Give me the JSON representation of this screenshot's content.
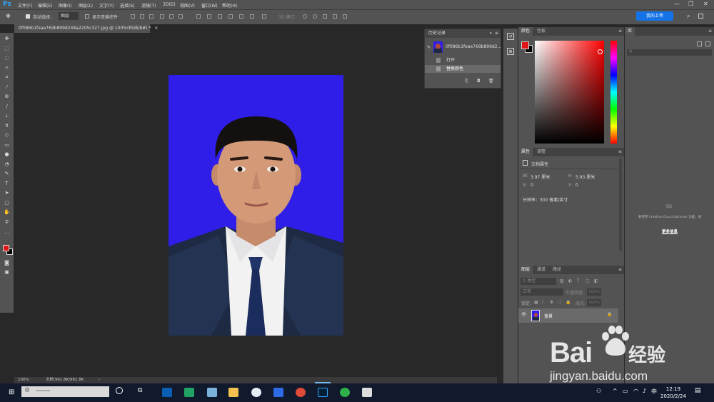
{
  "app": {
    "logo": "Ps"
  },
  "menu": [
    "文件(F)",
    "编辑(E)",
    "图像(I)",
    "图层(L)",
    "文字(Y)",
    "选择(S)",
    "滤镜(T)",
    "3D(D)",
    "视图(V)",
    "窗口(W)",
    "帮助(H)"
  ],
  "options": {
    "auto_select_label": "自动选择：",
    "auto_select_value": "图层",
    "show_transform_label": "显示变换控件",
    "mode_3d_label": "3D 模式：",
    "cloud_button": "我的上传"
  },
  "document": {
    "tab_title": "0f086b1feae769b899d248a2205c327.jpg @ 100%(RGB/8#) *",
    "zoom": "100%",
    "doc_info": "文档:961.8K/961.8K"
  },
  "history": {
    "tabs": [
      "历史记录"
    ],
    "snapshot": "0f086b1feae769b899d2...",
    "items": [
      "打开",
      "替换颜色"
    ]
  },
  "color_panel": {
    "tabs": [
      "颜色",
      "色板"
    ],
    "foreground": "#e01515",
    "background": "#000000"
  },
  "properties_panel": {
    "tabs": [
      "属性",
      "调整"
    ],
    "section": "文档属性",
    "w_label": "W:",
    "w_value": "3.97 厘米",
    "h_label": "H:",
    "h_value": "5.93 厘米",
    "x_label": "X:",
    "x_value": "0",
    "y_label": "Y:",
    "y_value": "0",
    "resolution": "分辨率：300 像素/英寸"
  },
  "layers_panel": {
    "tabs": [
      "图层",
      "通道",
      "路径"
    ],
    "kind": "类型",
    "blend_mode": "正常",
    "opacity_label": "不透明度:",
    "opacity_value": "100%",
    "lock_label": "锁定:",
    "fill_label": "填充:",
    "fill_value": "100%",
    "layer_name": "背景"
  },
  "library_panel": {
    "tabs": [
      "库"
    ],
    "message": "要使用 Creative Cloud Libraries 功能，请",
    "link": "更多信息"
  },
  "taskbar": {
    "time": "12:19",
    "date": "2020/2/24"
  },
  "watermark": {
    "brand": "Bai",
    "brand2": "经验",
    "url": "jingyan.baidu.com"
  }
}
